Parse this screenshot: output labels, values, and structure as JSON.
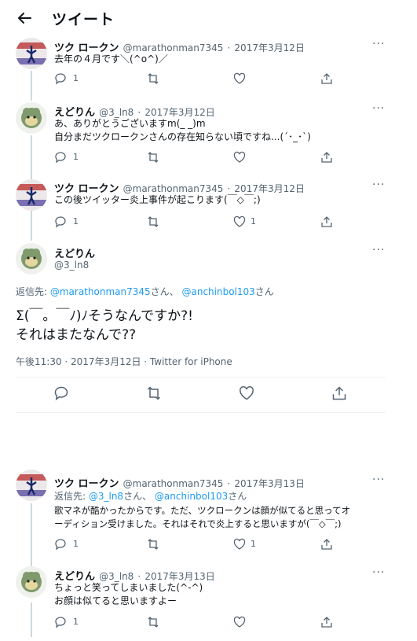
{
  "header": {
    "title": "ツイート"
  },
  "tweets": [
    {
      "name": "ツク ロークン",
      "handle": "@marathonman7345",
      "date": "2017年3月12日",
      "text": "去年の４月です＼(^o^)／",
      "replies": "1",
      "retweets": "",
      "likes": ""
    },
    {
      "name": "えどりん",
      "handle": "@3_ln8",
      "date": "2017年3月12日",
      "text": "あ、ありがとうございますm(_ _)m\n自分まだツクロークンさんの存在知らない頃ですね...(´･_･`)",
      "replies": "1",
      "retweets": "",
      "likes": ""
    },
    {
      "name": "ツク ロークン",
      "handle": "@marathonman7345",
      "date": "2017年3月12日",
      "text": "この後ツイッター炎上事件が起こります(￣◇￣;)",
      "replies": "1",
      "retweets": "",
      "likes": "1"
    }
  ],
  "main": {
    "name": "えどりん",
    "handle": "@3_ln8",
    "reply_prefix": "返信先: ",
    "reply_user1": "@marathonman7345",
    "reply_san1": "さん、",
    "reply_user2": "@anchinbol103",
    "reply_san2": "さん",
    "text_line1": "Σ(￣。￣ﾉ)ﾉそうなんですか?!",
    "text_line2": "それはまたなんで??",
    "timestamp": "午後11:30 · 2017年3月12日 · Twitter for iPhone"
  },
  "later": [
    {
      "name": "ツク ロークン",
      "handle": "@marathonman7345",
      "date": "2017年3月13日",
      "reply_prefix": "返信先: ",
      "reply_user1": "@3_ln8",
      "reply_san1": "さん、",
      "reply_user2": "@anchinbol103",
      "reply_san2": "さん",
      "text": "歌マネが酷かったからです。ただ、ツクロークンは顔が似てると思ってオ\nーディション受けました。それはそれで炎上すると思いますが(￣◇￣;)",
      "replies": "1",
      "retweets": "",
      "likes": "1"
    },
    {
      "name": "えどりん",
      "handle": "@3_ln8",
      "date": "2017年3月13日",
      "text": "ちょっと笑ってしまいました(^-^)\nお顔は似てると思いますよー",
      "replies": "1",
      "retweets": "",
      "likes": ""
    }
  ],
  "sep": "·",
  "more_glyph": "···",
  "colors": {
    "accent": "#1d9bf0",
    "muted": "#536471",
    "line": "#cfd9de"
  },
  "icons": [
    "back-arrow-icon",
    "reply-icon",
    "retweet-icon",
    "like-icon",
    "share-icon",
    "more-icon"
  ]
}
